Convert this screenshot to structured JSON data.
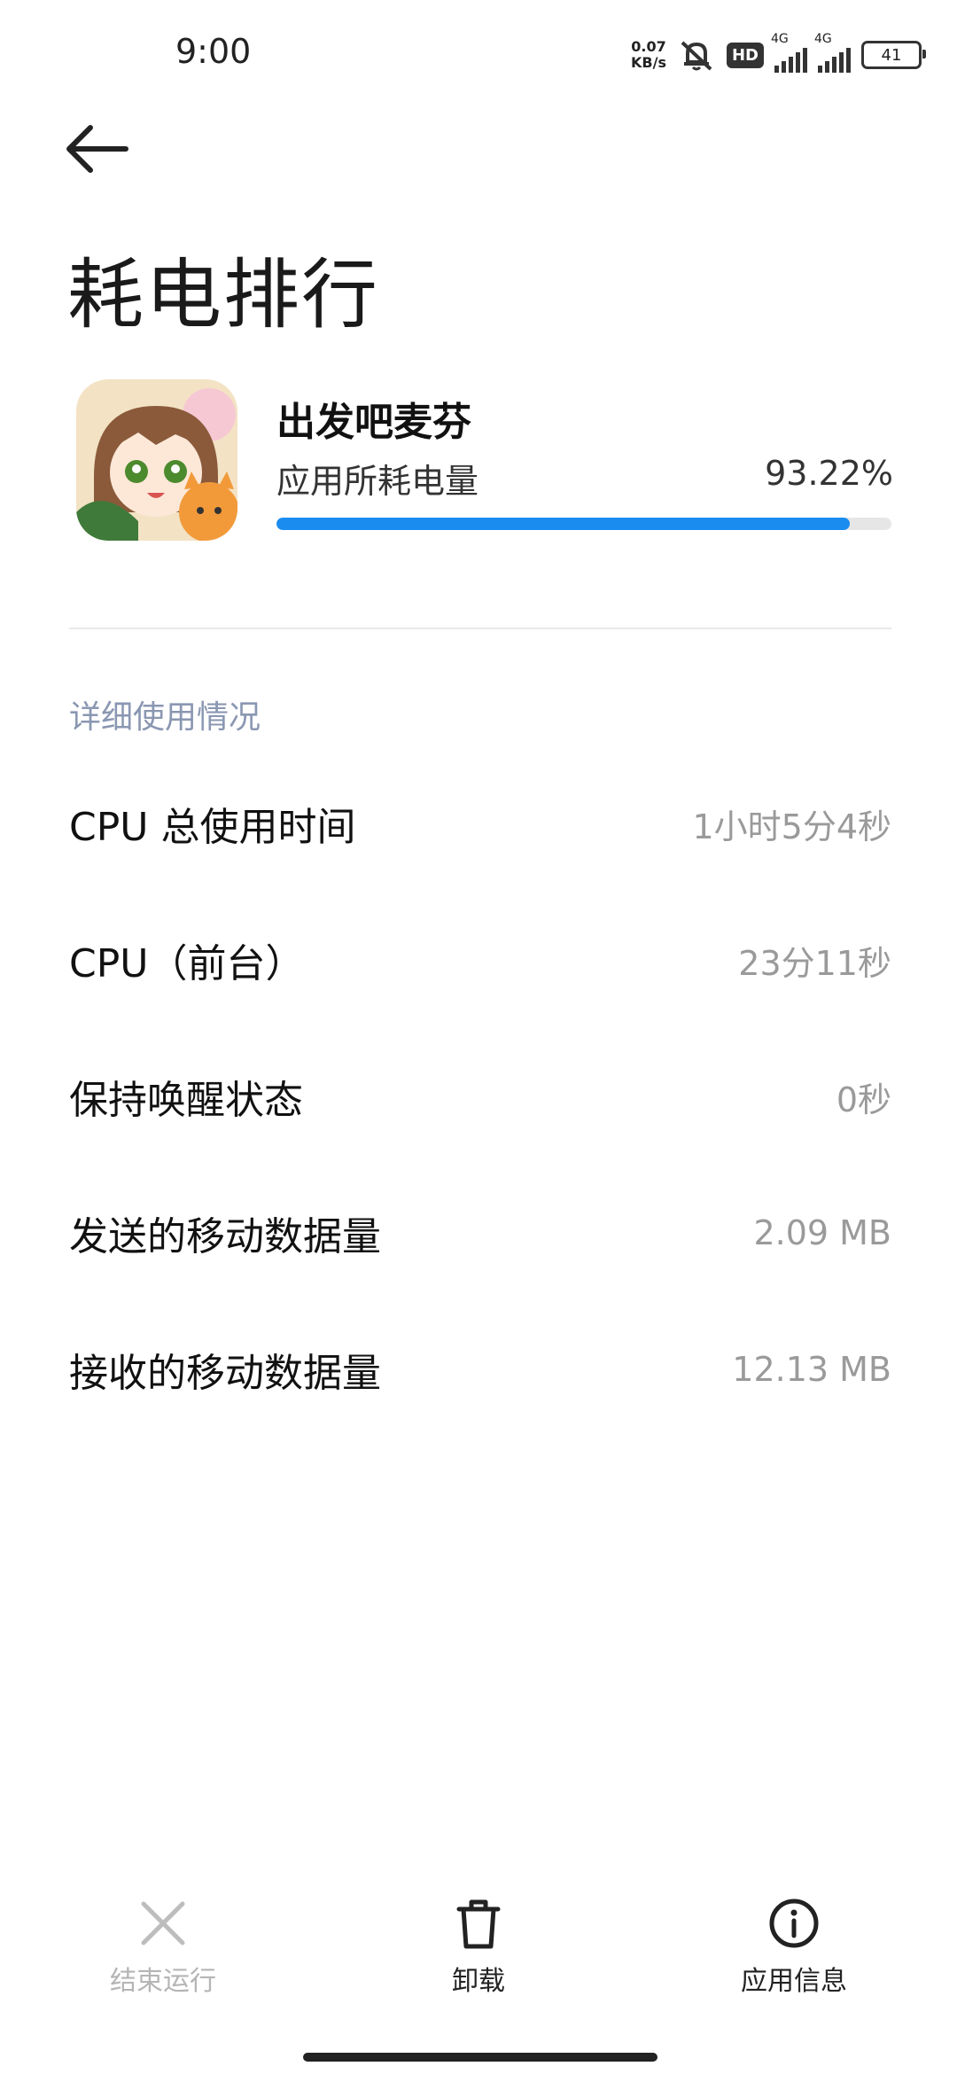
{
  "status_bar": {
    "time": "9:00",
    "net_speed_value": "0.07",
    "net_speed_unit": "KB/s",
    "hd_label": "HD",
    "sim1_label": "4G",
    "sim2_label": "4G",
    "battery": "41"
  },
  "header": {
    "back_icon": "arrow-left-icon",
    "title": "耗电排行"
  },
  "app": {
    "name": "出发吧麦芬",
    "usage_label": "应用所耗电量",
    "usage_value": "93.22%",
    "usage_fraction": 0.9322,
    "accent_color": "#1a8cf0"
  },
  "details": {
    "section_title": "详细使用情况",
    "rows": [
      {
        "label": "CPU 总使用时间",
        "value": "1小时5分4秒"
      },
      {
        "label": "CPU（前台）",
        "value": "23分11秒"
      },
      {
        "label": "保持唤醒状态",
        "value": "0秒"
      },
      {
        "label": "发送的移动数据量",
        "value": "2.09 MB"
      },
      {
        "label": "接收的移动数据量",
        "value": "12.13 MB"
      }
    ]
  },
  "bottom_bar": {
    "stop": {
      "label": "结束运行",
      "icon": "close-icon",
      "enabled": false
    },
    "uninstall": {
      "label": "卸载",
      "icon": "trash-icon"
    },
    "info": {
      "label": "应用信息",
      "icon": "info-icon"
    }
  }
}
